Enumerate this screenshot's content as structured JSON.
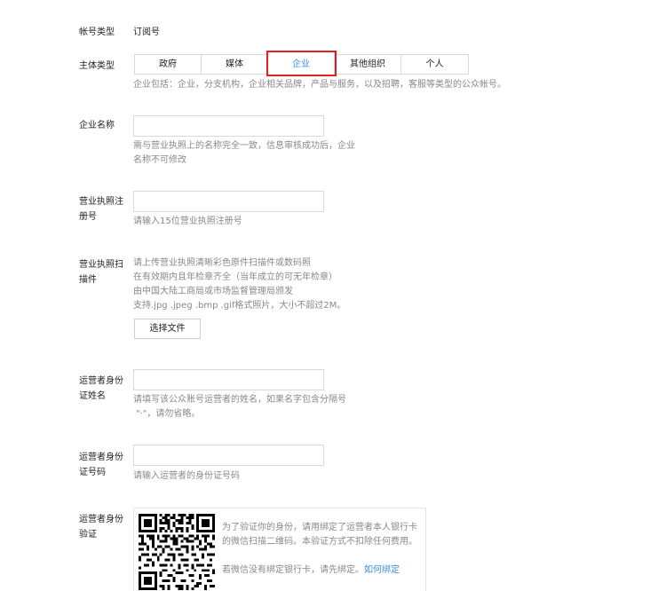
{
  "account_type": {
    "label": "帐号类型",
    "value": "订阅号"
  },
  "entity_type": {
    "label": "主体类型",
    "options": [
      "政府",
      "媒体",
      "企业",
      "其他组织",
      "个人"
    ],
    "selected_index": 2,
    "hint": "企业包括：企业，分支机构，企业相关品牌，产品与服务，以及招聘，客服等类型的公众帐号。"
  },
  "company_name": {
    "label": "企业名称",
    "value": "",
    "hint_line1": "需与营业执照上的名称完全一致，信息审核成功后，企业",
    "hint_line2": "名称不可修改"
  },
  "license_number": {
    "label_line1": "营业执照注",
    "label_line2": "册号",
    "value": "",
    "hint": "请输入15位营业执照注册号"
  },
  "license_scan": {
    "label_line1": "营业执照扫",
    "label_line2": "描件",
    "hint_lines": [
      "请上传营业执照清晰彩色原件扫描件或数码照",
      "在有效期内且年检章齐全（当年成立的可无年检章）",
      "由中国大陆工商局或市场监督管理局颁发",
      "支持.jpg .jpeg .bmp .gif格式照片，大小不超过2M。"
    ],
    "button_label": "选择文件"
  },
  "operator_name": {
    "label_line1": "运营者身份",
    "label_line2": "证姓名",
    "value": "",
    "hint_line1": "请填写该公众账号运营者的姓名，如果名字包含分隔号",
    "hint_line2": "\"·\"，请勿省略。"
  },
  "operator_id": {
    "label_line1": "运营者身份",
    "label_line2": "证号码",
    "value": "",
    "hint": "请输入运营者的身份证号码"
  },
  "operator_verify": {
    "label_line1": "运营者身份",
    "label_line2": "验证",
    "desc_line1": "为了验证你的身份，请用绑定了运营者本人银行卡",
    "desc_line2": "的微信扫描二维码。本验证方式不扣除任何费用。",
    "no_card_text": "若微信没有绑定银行卡，请先绑定。",
    "bind_link": "如何绑定"
  }
}
